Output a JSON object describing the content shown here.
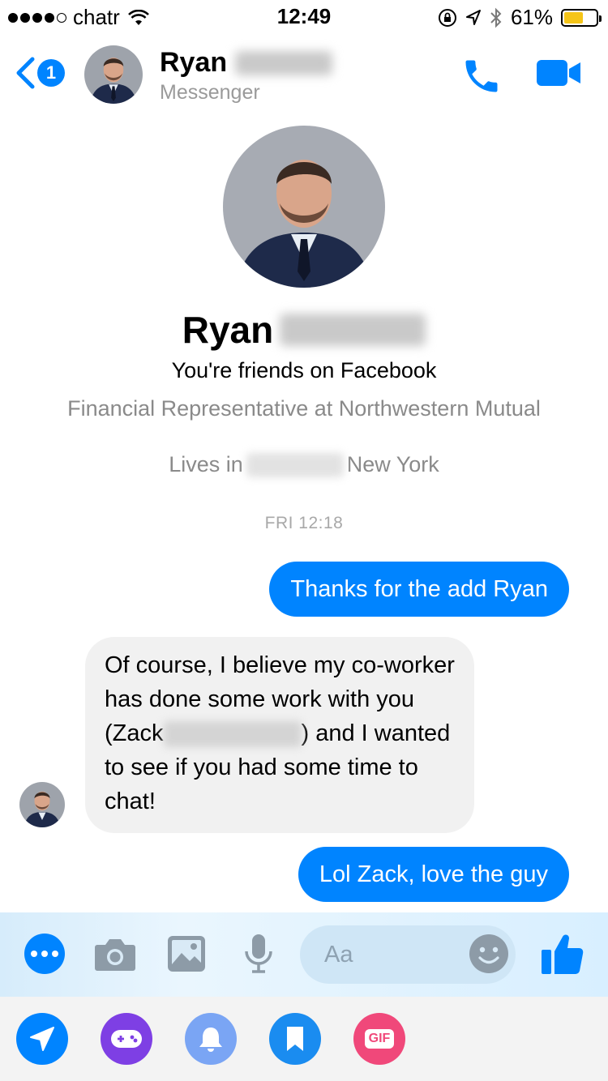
{
  "status_bar": {
    "carrier": "chatr",
    "time": "12:49",
    "battery_percent": "61%",
    "battery_level": 0.61
  },
  "header": {
    "back_badge": "1",
    "contact_first_name": "Ryan",
    "subtitle": "Messenger"
  },
  "profile": {
    "name": "Ryan",
    "friends_text": "You're friends on Facebook",
    "work": "Financial Representative at Northwestern Mutual",
    "lives_prefix": "Lives in",
    "lives_suffix": "New York"
  },
  "conversation": {
    "timestamp": "FRI 12:18",
    "messages": [
      {
        "direction": "outgoing",
        "text": "Thanks for the add Ryan"
      },
      {
        "direction": "incoming",
        "text_before": "Of course, I believe my co-worker has done some work with you (Zack",
        "text_after": ") and I wanted to see if you had some time to chat!"
      },
      {
        "direction": "outgoing",
        "text": "Lol Zack, love the guy"
      }
    ]
  },
  "composer": {
    "placeholder": "Aa",
    "icons": [
      "more-icon",
      "camera-icon",
      "image-icon",
      "microphone-icon",
      "emoji-icon",
      "thumbs-up-icon"
    ]
  },
  "tray": {
    "gif_label": "GIF",
    "icons": [
      "send-location-icon",
      "game-controller-icon",
      "bell-icon",
      "bookmark-icon",
      "gif-icon"
    ]
  },
  "colors": {
    "accent": "#0084ff",
    "incoming_bubble": "#f1f1f1",
    "game": "#7e3fe4",
    "gif": "#f0487a"
  }
}
